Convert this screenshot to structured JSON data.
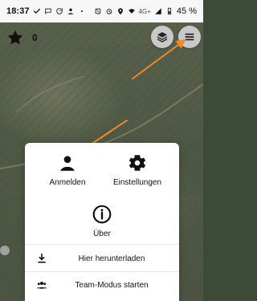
{
  "statusbar": {
    "time": "18:37",
    "battery_text": "45 %",
    "network_text": "4G+"
  },
  "score": {
    "count": "0",
    "icon": "star-icon"
  },
  "controls": {
    "layers_icon": "layers-icon",
    "menu_icon": "menu-icon"
  },
  "sheet": {
    "login_label": "Anmelden",
    "settings_label": "Einstellungen",
    "about_label": "Über",
    "download_label": "Hier herunterladen",
    "team_label": "Team-Modus starten",
    "login_icon": "person-icon",
    "settings_icon": "gear-icon",
    "about_icon": "info-icon",
    "download_icon": "download-icon",
    "team_icon": "team-icon"
  },
  "colors": {
    "arrow": "#f08a2a",
    "sheet": "#ffffff",
    "control_bg": "#d2d2d2"
  }
}
